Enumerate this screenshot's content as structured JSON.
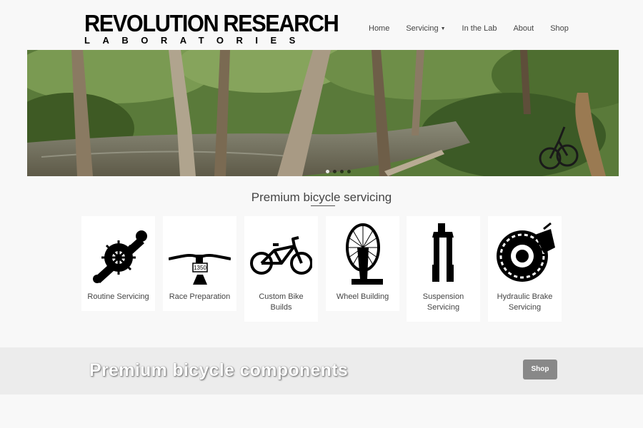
{
  "brand": {
    "line1": "REVOLUTION RESEARCH",
    "line2": "LABORATORIES"
  },
  "nav": [
    {
      "label": "Home"
    },
    {
      "label": "Servicing",
      "dropdown": true
    },
    {
      "label": "In the Lab"
    },
    {
      "label": "About"
    },
    {
      "label": "Shop"
    }
  ],
  "hero": {
    "slides": 4,
    "active_slide": 1
  },
  "section": {
    "title": "Premium bicycle servicing"
  },
  "services": [
    {
      "label": "Routine Servicing",
      "icon": "crankset-icon"
    },
    {
      "label": "Race Preparation",
      "icon": "handlebar-icon",
      "plate": "1350"
    },
    {
      "label": "Custom Bike Builds",
      "icon": "bicycle-icon"
    },
    {
      "label": "Wheel Building",
      "icon": "wheel-truing-stand-icon"
    },
    {
      "label": "Suspension Servicing",
      "icon": "suspension-fork-icon"
    },
    {
      "label": "Hydraulic Brake Servicing",
      "icon": "disc-brake-icon"
    }
  ],
  "components": {
    "title": "Premium bicycle components",
    "button": "Shop"
  },
  "colors": {
    "band": "#ececec",
    "button": "#888888",
    "background": "#f8f8f8"
  }
}
